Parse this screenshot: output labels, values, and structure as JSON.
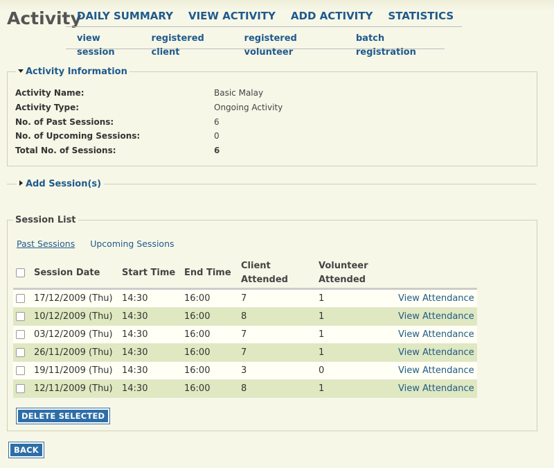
{
  "page": {
    "title": "Activity"
  },
  "main_nav": [
    {
      "label": "DAILY SUMMARY"
    },
    {
      "label": "VIEW ACTIVITY"
    },
    {
      "label": "ADD ACTIVITY"
    },
    {
      "label": "STATISTICS"
    }
  ],
  "sub_nav": [
    {
      "label": "view session"
    },
    {
      "label": "registered client"
    },
    {
      "label": "registered volunteer"
    },
    {
      "label": "batch registration"
    }
  ],
  "activity_info": {
    "legend": "Activity Information",
    "rows": [
      {
        "label": "Activity Name:",
        "value": "Basic Malay"
      },
      {
        "label": "Activity Type:",
        "value": "Ongoing Activity"
      },
      {
        "label": "No. of Past Sessions:",
        "value": "6"
      },
      {
        "label": "No. of Upcoming Sessions:",
        "value": "0"
      },
      {
        "label": "Total No. of Sessions:",
        "value": "6"
      }
    ]
  },
  "add_session": {
    "legend": "Add Session(s)"
  },
  "session_list": {
    "legend": "Session List",
    "tabs": [
      {
        "label": "Past Sessions"
      },
      {
        "label": "Upcoming Sessions"
      }
    ],
    "headers": {
      "date": "Session Date",
      "start": "Start Time",
      "end": "End Time",
      "client_1": "Client",
      "client_2": "Attended",
      "volunteer_1": "Volunteer",
      "volunteer_2": "Attended"
    },
    "rows": [
      {
        "date": "17/12/2009 (Thu)",
        "start": "14:30",
        "end": "16:00",
        "client": "7",
        "volunteer": "1",
        "link": "View Attendance"
      },
      {
        "date": "10/12/2009 (Thu)",
        "start": "14:30",
        "end": "16:00",
        "client": "8",
        "volunteer": "1",
        "link": "View Attendance"
      },
      {
        "date": "03/12/2009 (Thu)",
        "start": "14:30",
        "end": "16:00",
        "client": "7",
        "volunteer": "1",
        "link": "View Attendance"
      },
      {
        "date": "26/11/2009 (Thu)",
        "start": "14:30",
        "end": "16:00",
        "client": "7",
        "volunteer": "1",
        "link": "View Attendance"
      },
      {
        "date": "19/11/2009 (Thu)",
        "start": "14:30",
        "end": "16:00",
        "client": "3",
        "volunteer": "0",
        "link": "View Attendance"
      },
      {
        "date": "12/11/2009 (Thu)",
        "start": "14:30",
        "end": "16:00",
        "client": "8",
        "volunteer": "1",
        "link": "View Attendance"
      }
    ],
    "delete_label": "DELETE SELECTED"
  },
  "back_label": "BACK"
}
